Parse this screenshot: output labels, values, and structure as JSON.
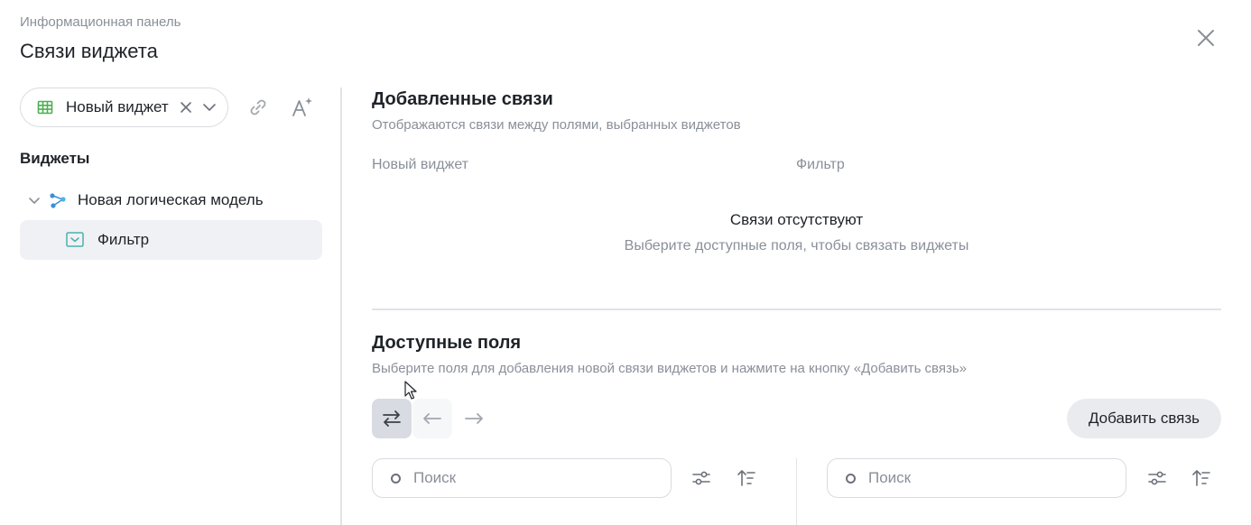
{
  "header": {
    "breadcrumb": "Информационная панель",
    "title": "Связи виджета",
    "close_icon": "close-icon"
  },
  "sidebar": {
    "widget_select": {
      "value": "Новый виджет",
      "icon": "table-icon"
    },
    "tools": {
      "link_icon": "link-icon",
      "ai_icon": "ai-text-icon"
    },
    "section_title": "Виджеты",
    "tree": {
      "model": {
        "label": "Новая логическая модель",
        "icon": "logical-model-icon"
      },
      "items": [
        {
          "label": "Фильтр",
          "icon": "filter-widget-icon"
        }
      ]
    }
  },
  "added_links": {
    "title": "Добавленные связи",
    "subtitle": "Отображаются связи между полями, выбранных виджетов",
    "column_left": "Новый виджет",
    "column_right": "Фильтр",
    "empty_title": "Связи отсутствуют",
    "empty_subtitle": "Выберите доступные поля, чтобы связать виджеты"
  },
  "available_fields": {
    "title": "Доступные поля",
    "subtitle": "Выберите поля для добавления новой связи виджетов и нажмите на кнопку «Добавить связь»",
    "directions": [
      "both-directions-icon",
      "arrow-left-icon",
      "arrow-right-icon"
    ],
    "add_button": "Добавить связь",
    "search_left_placeholder": "Поиск",
    "search_right_placeholder": "Поиск"
  },
  "colors": {
    "accent_green": "#4caf50",
    "accent_blue": "#3b8fd9",
    "muted_text": "#8a8f99"
  }
}
